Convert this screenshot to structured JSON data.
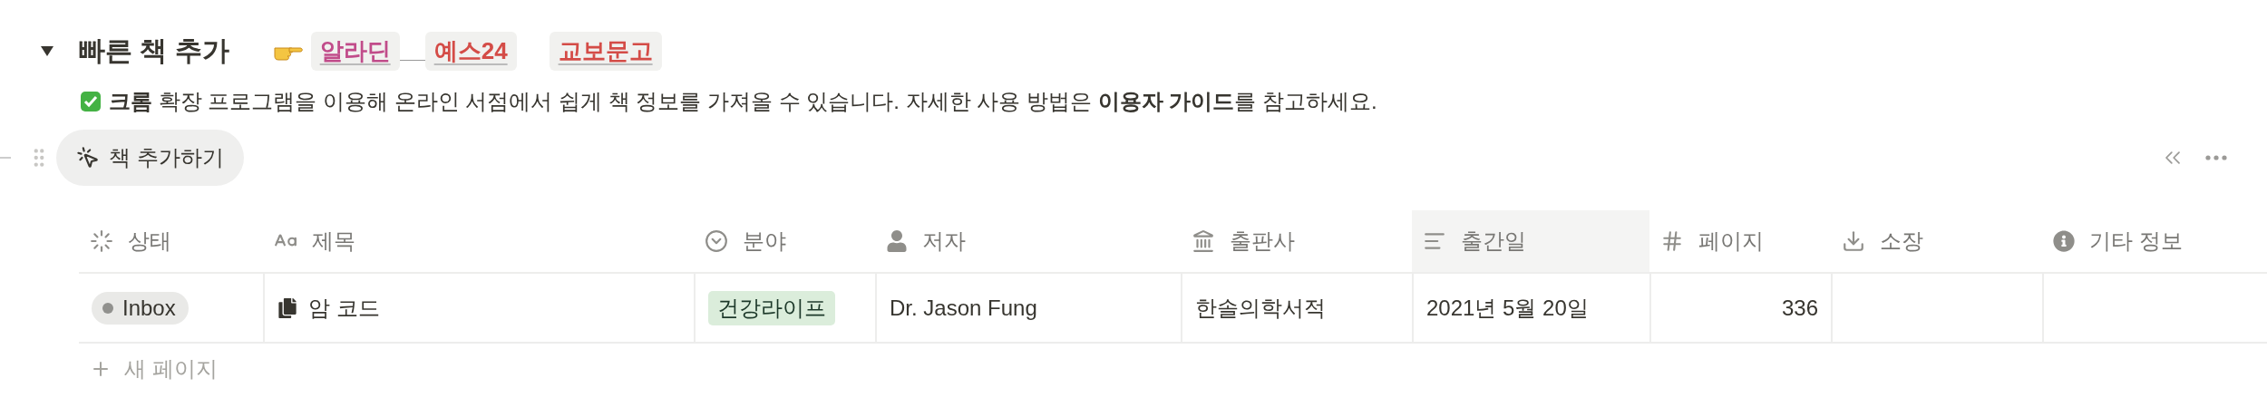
{
  "section": {
    "title": "빠른 책 추가",
    "expanded": true,
    "links": [
      {
        "label": "알라딘",
        "color": "#c14c8a"
      },
      {
        "label": "예스24",
        "color": "#d44c47"
      },
      {
        "label": "교보문고",
        "color": "#d44c47"
      }
    ],
    "description": "**크롬** 확장 프로그램을 이용해 온라인 서점에서 쉽게 책 정보를 가져올 수 있습니다. 자세한 사용 방법은 **이용자 가이드**를 참고하세요."
  },
  "add_button": {
    "label": "책 추가하기"
  },
  "table": {
    "columns": [
      {
        "label": "상태",
        "kind": "status",
        "highlighted": false
      },
      {
        "label": "제목",
        "kind": "title",
        "highlighted": false
      },
      {
        "label": "분야",
        "kind": "select",
        "highlighted": false
      },
      {
        "label": "저자",
        "kind": "person",
        "highlighted": false
      },
      {
        "label": "출판사",
        "kind": "building",
        "highlighted": false
      },
      {
        "label": "출간일",
        "kind": "date",
        "highlighted": true
      },
      {
        "label": "페이지",
        "kind": "number",
        "highlighted": false
      },
      {
        "label": "소장",
        "kind": "download",
        "highlighted": false
      },
      {
        "label": "기타 정보",
        "kind": "info",
        "highlighted": false
      }
    ],
    "rows": [
      {
        "cells": [
          {
            "kind": "status",
            "text": "Inbox",
            "color": "#91918e"
          },
          {
            "kind": "page",
            "text": "암 코드"
          },
          {
            "kind": "tag",
            "text": "건강라이프",
            "color": "#dbeddb"
          },
          {
            "kind": "text",
            "text": "Dr. Jason Fung"
          },
          {
            "kind": "text",
            "text": "한솔의학서적"
          },
          {
            "kind": "text",
            "text": "2021년 5월 20일"
          },
          {
            "kind": "number",
            "text": "336"
          },
          {
            "kind": "empty"
          },
          {
            "kind": "empty"
          }
        ]
      }
    ],
    "new_row": "새 페이지"
  }
}
